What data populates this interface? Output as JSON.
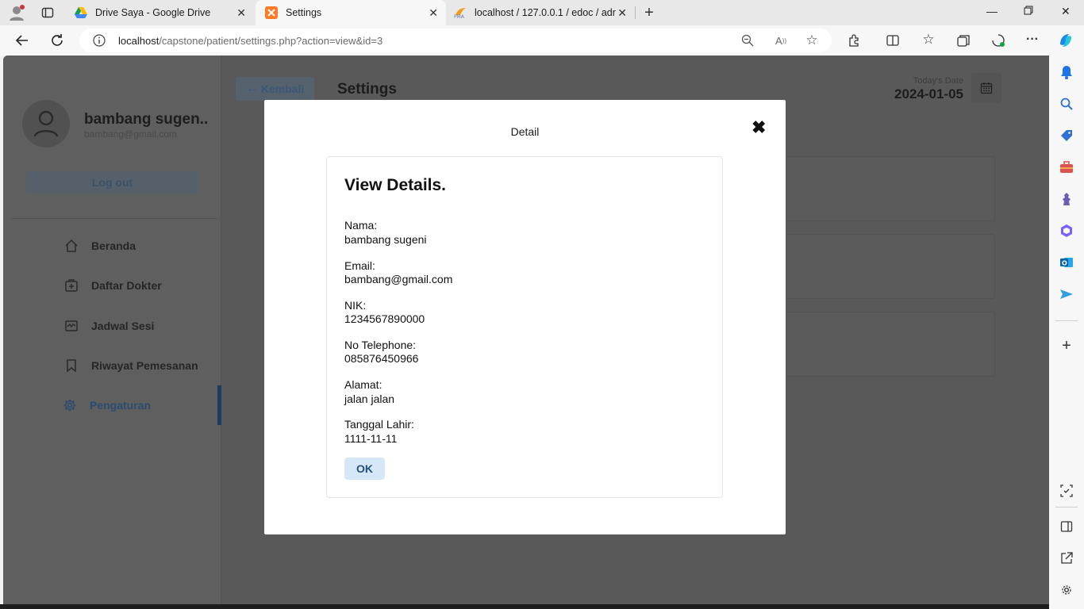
{
  "browser": {
    "tabs": [
      {
        "title": "Drive Saya - Google Drive",
        "active": false
      },
      {
        "title": "Settings",
        "active": true
      },
      {
        "title": "localhost / 127.0.0.1 / edoc / adr",
        "active": false
      }
    ],
    "url_host": "localhost",
    "url_path": "/capstone/patient/settings.php?action=view&id=3"
  },
  "sidebar": {
    "user_name": "bambang sugen..",
    "user_email": "bambang@gmail.com",
    "logout_label": "Log out",
    "items": [
      {
        "label": "Beranda",
        "icon": "home-icon",
        "active": false
      },
      {
        "label": "Daftar Dokter",
        "icon": "doctor-icon",
        "active": false
      },
      {
        "label": "Jadwal Sesi",
        "icon": "schedule-icon",
        "active": false
      },
      {
        "label": "Riwayat Pemesanan",
        "icon": "bookmark-icon",
        "active": false
      },
      {
        "label": "Pengaturan",
        "icon": "gear-icon",
        "active": true
      }
    ]
  },
  "header": {
    "back_label": "Kembali",
    "title": "Settings",
    "today_label": "Today's Date",
    "today_date": "2024-01-05"
  },
  "modal": {
    "title": "Detail",
    "heading": "View Details.",
    "fields": [
      {
        "label": "Nama:",
        "value": "bambang sugeni"
      },
      {
        "label": "Email:",
        "value": "bambang@gmail.com"
      },
      {
        "label": "NIK:",
        "value": "1234567890000"
      },
      {
        "label": "No Telephone:",
        "value": "085876450966"
      },
      {
        "label": "Alamat:",
        "value": "jalan jalan"
      },
      {
        "label": "Tanggal Lahir:",
        "value": "1111-11-11"
      }
    ],
    "ok_label": "OK"
  },
  "colors": {
    "overlay_page": "#595959",
    "active_nav": "#1f3c63",
    "ok_button_bg": "#d6e8f8"
  }
}
